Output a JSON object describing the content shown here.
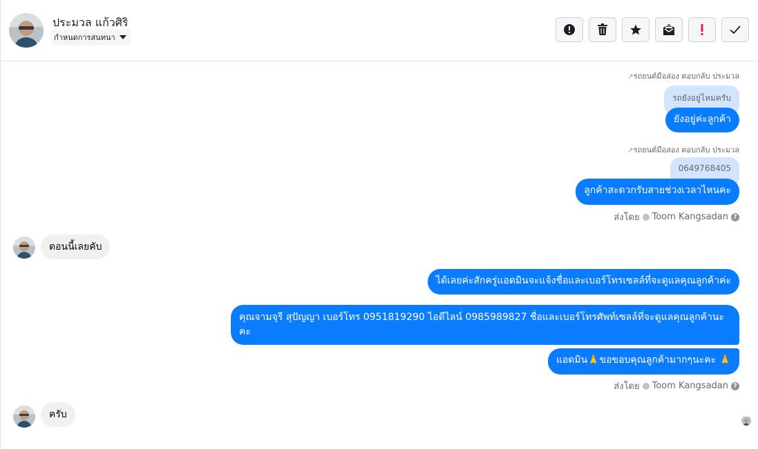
{
  "header": {
    "contact_name": "ประมวล แก้วศิริ",
    "assign_label": "กำหนดการสนทนา"
  },
  "toolbar": [
    {
      "name": "spam-button",
      "icon": "alert-circle-icon"
    },
    {
      "name": "delete-button",
      "icon": "trash-icon"
    },
    {
      "name": "star-button",
      "icon": "star-icon"
    },
    {
      "name": "mark-unread-button",
      "icon": "envelope-icon"
    },
    {
      "name": "follow-up-button",
      "icon": "exclamation-icon"
    },
    {
      "name": "done-button",
      "icon": "check-icon"
    }
  ],
  "messages": {
    "m1": {
      "meta": "รถยนต์มือสอง ตอบกลับ ประมวล",
      "quoted": "รถยังอยู่ไหมครับ",
      "text": "ยังอยู่ค่ะลูกค้า"
    },
    "m2": {
      "meta": "รถยนต์มือสอง ตอบกลับ ประมวล",
      "quoted": "0649768405",
      "text": "ลูกค้าสะดวกรับสายช่วงเวลาไหนคะ"
    },
    "sent_by_1": {
      "prefix": "ส่งโดย",
      "name": "Toom Kangsadan"
    },
    "in1": "ตอนนี้เลยคับ",
    "out3": "ได้เลยค่ะสักครู่แอดมินจะแจ้งชื่อและเบอร์โทรเซลล์ที่จะดูแลคุณลูกค้าค่ะ",
    "out4": "คุณจามจุรี สุปัญญา เบอร์โทร 0951819290 ไอดีไลน์ 0985989827 ชื่อและเบอร์โทรศัพท์เซลล์ที่จะดูแลคุณลูกค้านะคะ",
    "out5": "แอดมิน🙏ขอขอบคุณลูกค้ามากๆนะคะ 🙏",
    "sent_by_2": {
      "prefix": "ส่งโดย",
      "name": "Toom Kangsadan"
    },
    "in2": "ครับ"
  },
  "colors": {
    "accent": "#0a7cff",
    "quote_bg": "#d3e5fd",
    "incoming_bg": "#f0f0f0"
  }
}
